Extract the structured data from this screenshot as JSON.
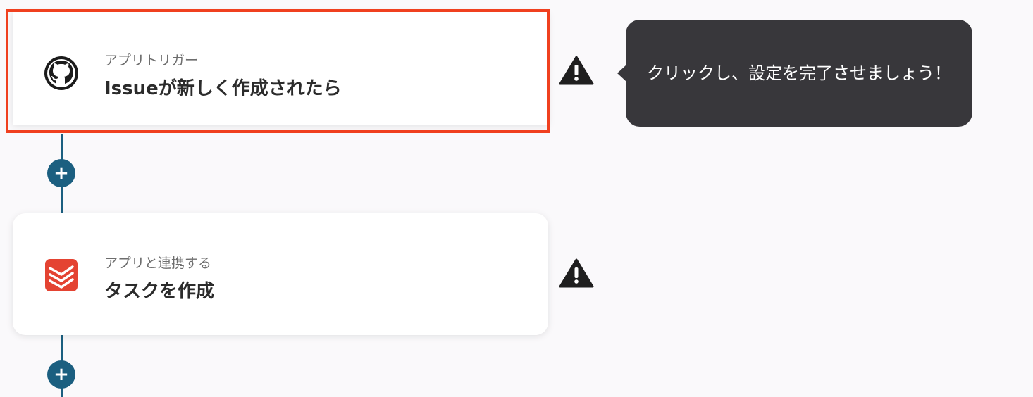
{
  "flow": {
    "steps": [
      {
        "subtitle": "アプリトリガー",
        "title": "Issueが新しく作成されたら",
        "icon": "github-icon",
        "selected": true
      },
      {
        "subtitle": "アプリと連携する",
        "title": "タスクを作成",
        "icon": "todoist-icon",
        "selected": false
      }
    ],
    "add_step_label": "+"
  },
  "tooltip": {
    "text": "クリックし、設定を完了させましょう！"
  },
  "colors": {
    "connector": "#1b5f80",
    "highlight_border": "#f0401f",
    "tooltip_bg": "#38373b",
    "todoist_red": "#e44332",
    "warning": "#1f1f1f"
  }
}
